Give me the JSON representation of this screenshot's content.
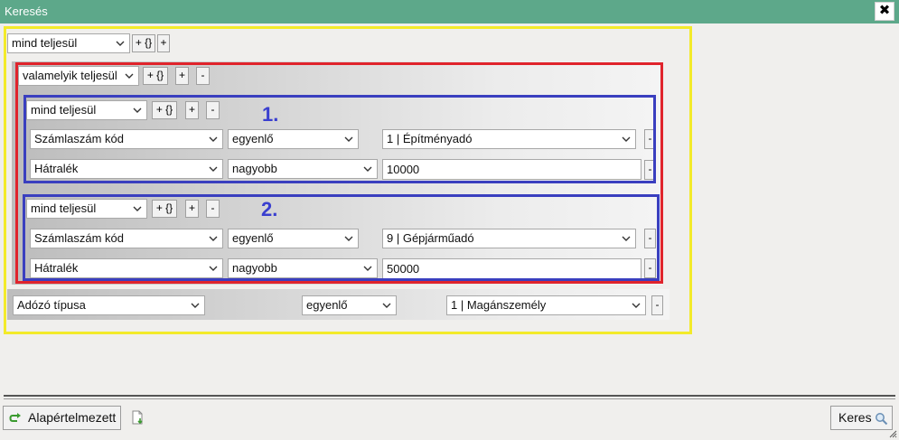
{
  "window": {
    "title": "Keresés",
    "close_label": "✖"
  },
  "root": {
    "mode": "mind teljesül",
    "add_condition_label": "+",
    "add_group_label": "+ {}",
    "group": {
      "mode": "valamelyik teljesül",
      "add_group_label": "+ {}",
      "add_condition_label": "+",
      "remove_label": "-",
      "subgroups": [
        {
          "marker": "1.",
          "mode": "mind teljesül",
          "add_group_label": "+ {}",
          "add_condition_label": "+",
          "remove_label": "-",
          "conditions": [
            {
              "field": "Számlaszám kód",
              "operator": "egyenlő",
              "value": "1 | Építményadó",
              "remove_label": "-"
            },
            {
              "field": "Hátralék",
              "operator": "nagyobb",
              "value": "10000",
              "remove_label": "-"
            }
          ]
        },
        {
          "marker": "2.",
          "mode": "mind teljesül",
          "add_group_label": "+ {}",
          "add_condition_label": "+",
          "remove_label": "-",
          "conditions": [
            {
              "field": "Számlaszám kód",
              "operator": "egyenlő",
              "value": "9 | Gépjárműadó",
              "remove_label": "-"
            },
            {
              "field": "Hátralék",
              "operator": "nagyobb",
              "value": "50000",
              "remove_label": "-"
            }
          ]
        }
      ]
    },
    "condition": {
      "field": "Adózó típusa",
      "operator": "egyenlő",
      "value": "1 | Magánszemély",
      "remove_label": "-"
    }
  },
  "footer": {
    "defaults_label": "Alapértelmezett",
    "search_label": "Keres"
  },
  "colors": {
    "titlebar": "#5da88a",
    "outer_frame": "#f3ea2a",
    "group_frame": "#e0242c",
    "subgroup_frame": "#3a3fbf",
    "marker": "#3a3fcf"
  },
  "icons": [
    "close-icon",
    "chevron-down-icon",
    "reset-arrow-icon",
    "export-icon",
    "magnifier-icon",
    "resize-grip-icon"
  ]
}
